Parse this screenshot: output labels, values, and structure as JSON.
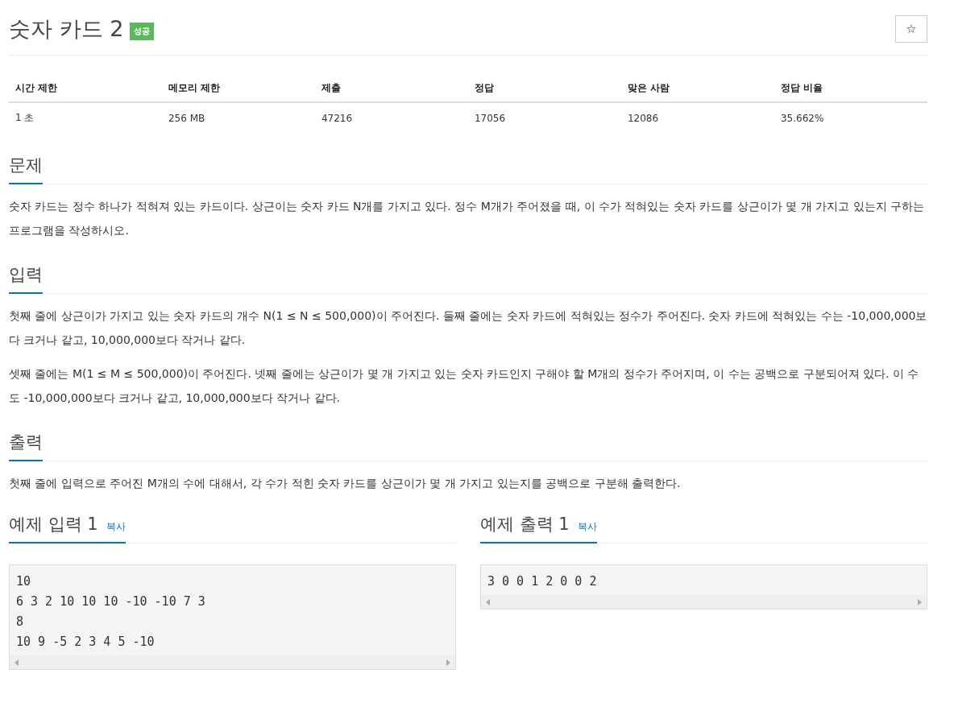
{
  "title": "숫자 카드 2",
  "status_badge": "성공",
  "star_button": "☆",
  "info_table": {
    "columns": [
      "시간 제한",
      "메모리 제한",
      "제출",
      "정답",
      "맞은 사람",
      "정답 비율"
    ],
    "rows": [
      [
        "1 초",
        "256 MB",
        "47216",
        "17056",
        "12086",
        "35.662%"
      ]
    ]
  },
  "sections": [
    {
      "heading": "문제",
      "paragraphs": [
        "숫자 카드는 정수 하나가 적혀져 있는 카드이다. 상근이는 숫자 카드 N개를 가지고 있다. 정수 M개가 주어졌을 때, 이 수가 적혀있는 숫자 카드를 상근이가 몇 개 가지고 있는지 구하는 프로그램을 작성하시오."
      ]
    },
    {
      "heading": "입력",
      "paragraphs": [
        "첫째 줄에 상근이가 가지고 있는 숫자 카드의 개수 N(1 ≤ N ≤ 500,000)이 주어진다. 둘째 줄에는 숫자 카드에 적혀있는 정수가 주어진다. 숫자 카드에 적혀있는 수는 -10,000,000보다 크거나 같고, 10,000,000보다 작거나 같다.",
        "셋째 줄에는 M(1 ≤ M ≤ 500,000)이 주어진다. 넷째 줄에는 상근이가 몇 개 가지고 있는 숫자 카드인지 구해야 할 M개의 정수가 주어지며, 이 수는 공백으로 구분되어져 있다. 이 수도 -10,000,000보다 크거나 같고, 10,000,000보다 작거나 같다."
      ]
    },
    {
      "heading": "출력",
      "paragraphs": [
        "첫째 줄에 입력으로 주어진 M개의 수에 대해서, 각 수가 적힌 숫자 카드를 상근이가 몇 개 가지고 있는지를 공백으로 구분해 출력한다."
      ]
    }
  ],
  "samples": [
    {
      "heading": "예제 입력 1",
      "copy_link": "복사",
      "lines": [
        "10",
        "6 3 2 10 10 10 -10 -10 7 3",
        "8",
        "10 9 -5 2 3 4 5 -10"
      ]
    },
    {
      "heading": "예제 출력 1",
      "copy_link": "복사",
      "lines": [
        "3 0 0 1 2 0 0 2"
      ]
    }
  ]
}
